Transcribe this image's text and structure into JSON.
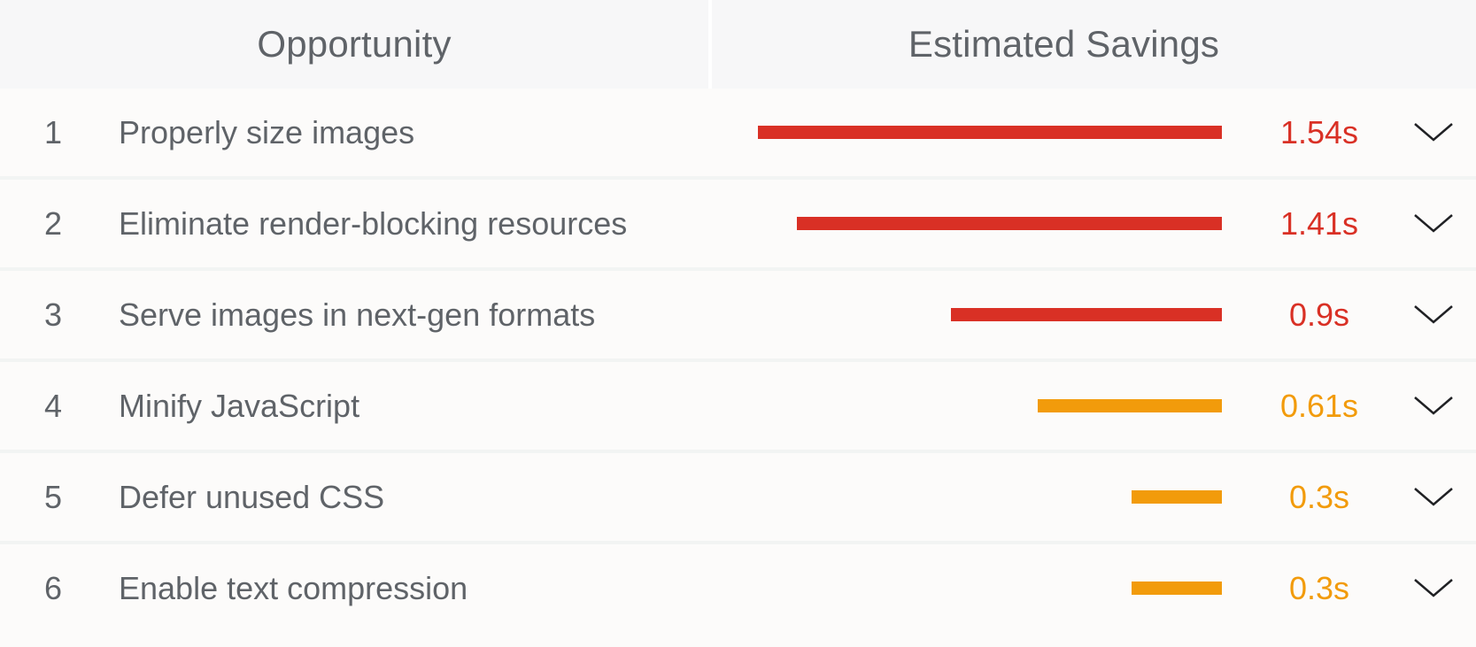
{
  "header": {
    "opportunity_label": "Opportunity",
    "savings_label": "Estimated Savings"
  },
  "scale_max_seconds": 1.54,
  "colors": {
    "fail": "#d93025",
    "average": "#f29b0b"
  },
  "rows": [
    {
      "index": "1",
      "title": "Properly size images",
      "savings_seconds": 1.54,
      "savings_label": "1.54s",
      "rating": "fail",
      "icon": "chevron-down-icon"
    },
    {
      "index": "2",
      "title": "Eliminate render-blocking resources",
      "savings_seconds": 1.41,
      "savings_label": "1.41s",
      "rating": "fail",
      "icon": "chevron-down-icon"
    },
    {
      "index": "3",
      "title": "Serve images in next-gen formats",
      "savings_seconds": 0.9,
      "savings_label": "0.9s",
      "rating": "fail",
      "icon": "chevron-down-icon"
    },
    {
      "index": "4",
      "title": "Minify JavaScript",
      "savings_seconds": 0.61,
      "savings_label": "0.61s",
      "rating": "average",
      "icon": "chevron-down-icon"
    },
    {
      "index": "5",
      "title": "Defer unused CSS",
      "savings_seconds": 0.3,
      "savings_label": "0.3s",
      "rating": "average",
      "icon": "chevron-down-icon"
    },
    {
      "index": "6",
      "title": "Enable text compression",
      "savings_seconds": 0.3,
      "savings_label": "0.3s",
      "rating": "average",
      "icon": "chevron-down-icon"
    }
  ]
}
